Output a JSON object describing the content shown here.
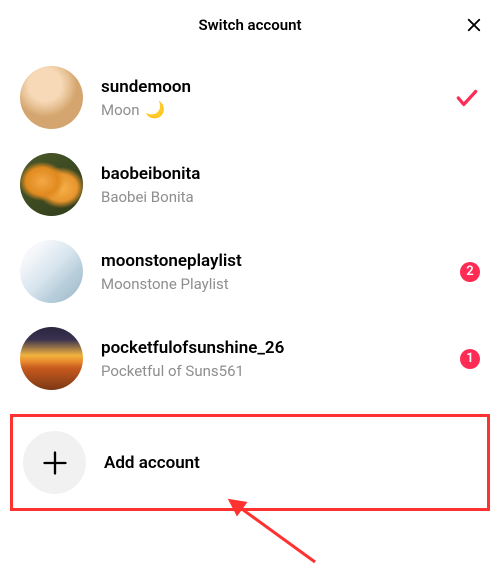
{
  "header": {
    "title": "Switch account"
  },
  "accounts": [
    {
      "username": "sundemoon",
      "display_name": "Moon",
      "emoji": "🌙",
      "selected": true,
      "badge_count": null
    },
    {
      "username": "baobeibonita",
      "display_name": "Baobei Bonita",
      "emoji": "",
      "selected": false,
      "badge_count": null
    },
    {
      "username": "moonstoneplaylist",
      "display_name": "Moonstone Playlist",
      "emoji": "",
      "selected": false,
      "badge_count": 2
    },
    {
      "username": "pocketfulofsunshine_26",
      "display_name": "Pocketful of Suns561",
      "emoji": "",
      "selected": false,
      "badge_count": 1
    }
  ],
  "add_account": {
    "label": "Add account"
  },
  "colors": {
    "accent": "#fe2c55",
    "highlight_border": "#ff3232"
  },
  "icons": {
    "close": "close-icon",
    "check": "check-icon",
    "plus": "plus-icon"
  }
}
